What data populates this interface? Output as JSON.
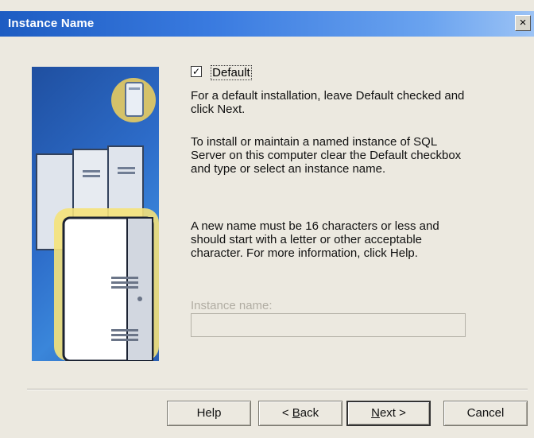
{
  "window": {
    "title": "Instance Name",
    "close_glyph": "×"
  },
  "checkbox": {
    "label": "Default",
    "checked": true,
    "glyph": "✓"
  },
  "paragraphs": [
    "For a default installation, leave Default checked and click Next.",
    "To install or maintain a named instance of SQL Server on this computer clear the Default checkbox and type or select an instance name.",
    "A new name must be 16 characters or less and should start with a letter or other acceptable character. For more information, click Help."
  ],
  "instance": {
    "label": "Instance name:",
    "value": ""
  },
  "buttons": {
    "help": "Help",
    "back_prefix": "< ",
    "back_accel": "B",
    "back_rest": "ack",
    "next_accel": "N",
    "next_rest": "ext >",
    "cancel": "Cancel"
  },
  "colors": {
    "titlebar": "#1d5cc2",
    "art_blue": "#2d6cc9",
    "disabled_text": "#b1ada3"
  }
}
